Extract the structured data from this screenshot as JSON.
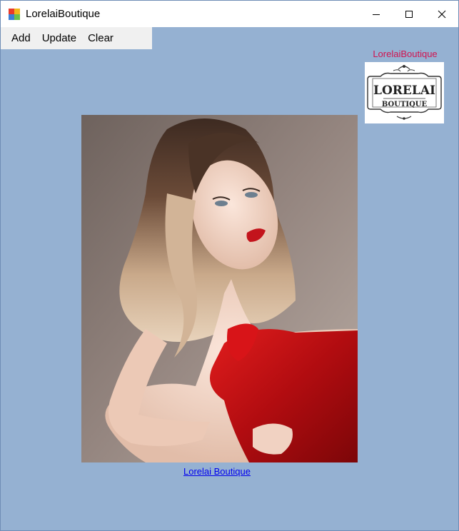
{
  "window": {
    "title": "LorelaiBoutique",
    "app_icon": "windows-form-icon",
    "controls": [
      "minimize-icon",
      "maximize-icon",
      "close-icon"
    ]
  },
  "menu": {
    "items": [
      "Add",
      "Update",
      "Clear"
    ]
  },
  "brand": {
    "label": "LorelaiBoutique",
    "logo_text_main": "LORELAI",
    "logo_text_sub": "BOUTIQUE"
  },
  "photo": {
    "description_icon": "model-red-dress-photo"
  },
  "footer_link": {
    "text": "Lorelai Boutique"
  },
  "colors": {
    "form_background": "#95b1d2",
    "brand_label": "#d1134f",
    "link": "#0000ee"
  }
}
